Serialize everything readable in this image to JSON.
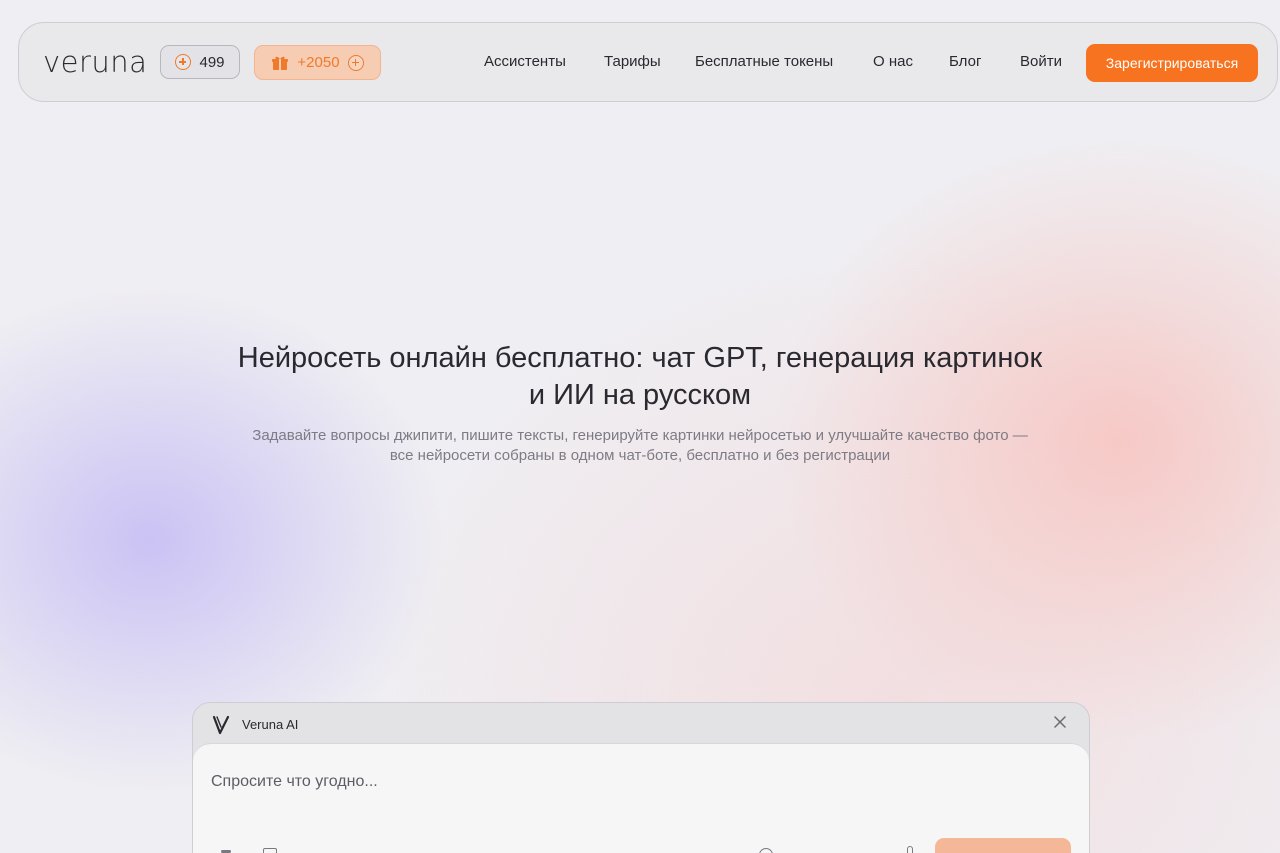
{
  "header": {
    "logo": "veruna",
    "tokens": "499",
    "bonus": "+2050",
    "nav": [
      "Ассистенты",
      "Тарифы",
      "Бесплатные токены",
      "О нас",
      "Блог",
      "Войти"
    ],
    "signup_label": "Зарегистрироваться"
  },
  "hero": {
    "title_line1": "Нейросеть онлайн бесплатно: чат GPT, генерация картинок",
    "title_line2": "и ИИ на русском",
    "subtitle_line1": "Задавайте вопросы джипити, пишите тексты, генерируйте картинки нейросетью и улучшайте качество фото —",
    "subtitle_line2": "все нейросети собраны в одном чат-боте, бесплатно и без регистрации"
  },
  "chat": {
    "name": "Veruna AI",
    "placeholder": "Спросите что угодно..."
  },
  "colors": {
    "accent": "#f7731f",
    "bonus_bg": "#f6cdb2"
  },
  "icons": [
    "plus-circle-icon",
    "gift-icon",
    "veruna-v-logo-icon",
    "close-icon",
    "attach-icon",
    "image-icon",
    "model-icon",
    "mic-icon"
  ]
}
